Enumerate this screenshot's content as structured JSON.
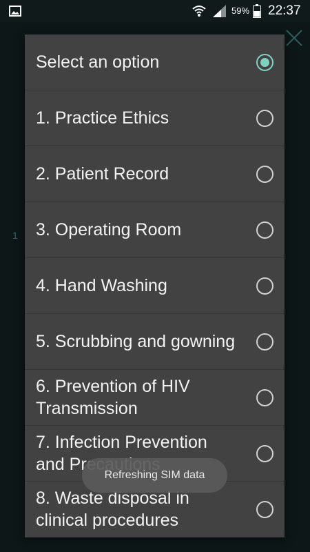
{
  "status_bar": {
    "battery_percent": "59%",
    "time": "22:37",
    "icons": [
      "gallery-icon",
      "wifi-icon",
      "signal-icon",
      "battery-icon"
    ]
  },
  "background": {
    "partial_text": "1"
  },
  "dialog": {
    "options": [
      {
        "label": "Select an option",
        "selected": true
      },
      {
        "label": "1. Practice Ethics",
        "selected": false
      },
      {
        "label": "2. Patient Record",
        "selected": false
      },
      {
        "label": "3. Operating Room",
        "selected": false
      },
      {
        "label": "4. Hand Washing",
        "selected": false
      },
      {
        "label": "5. Scrubbing and gowning",
        "selected": false
      },
      {
        "label": "6. Prevention of HIV Transmission",
        "selected": false
      },
      {
        "label": "7. Infection Prevention and Precautions",
        "selected": false
      },
      {
        "label": "8. Waste disposal in clinical procedures",
        "selected": false
      }
    ]
  },
  "toast": {
    "message": "Refreshing SIM data"
  },
  "colors": {
    "accent": "#7fd2c2",
    "dialog_background": "#424242",
    "screen_background": "#0d1718"
  }
}
